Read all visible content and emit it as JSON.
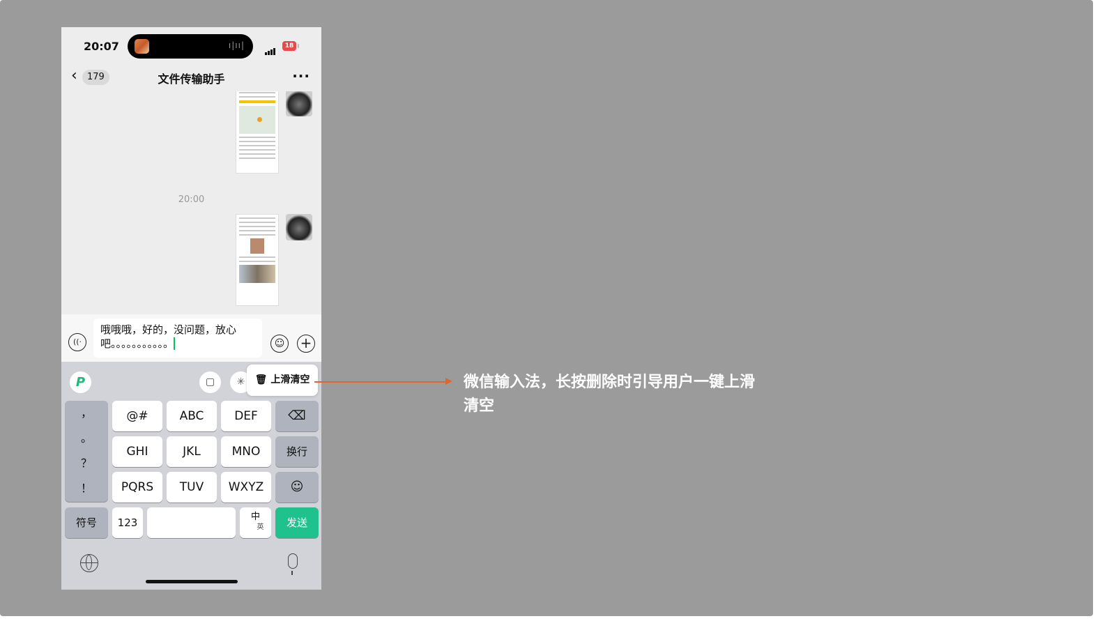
{
  "status_bar": {
    "time": "20:07",
    "battery": "18"
  },
  "nav": {
    "back_count": "179",
    "title": "文件传输助手",
    "more": "···"
  },
  "chat": {
    "timestamp": "20:00"
  },
  "input": {
    "text": "哦哦哦，好的，没问题，放心吧。。。。。。。。。。。"
  },
  "keyboard": {
    "tooltip": "上滑清空",
    "punctuation": [
      "，",
      "。",
      "？",
      "！"
    ],
    "row1": [
      "@#",
      "ABC",
      "DEF"
    ],
    "row2": [
      "GHI",
      "JKL",
      "MNO"
    ],
    "return_label": "换行",
    "row3": [
      "PQRS",
      "TUV",
      "WXYZ"
    ],
    "symbols_label": "符号",
    "numbers_label": "123",
    "lang_top": "中",
    "lang_bottom": "英",
    "send_label": "发送"
  },
  "annotation": {
    "text": "微信输入法，长按删除时引导用户一键上滑清空"
  },
  "colors": {
    "background": "#9b9b9b",
    "send": "#1fc18c",
    "arrow": "#e0662a",
    "caret": "#07c160"
  }
}
